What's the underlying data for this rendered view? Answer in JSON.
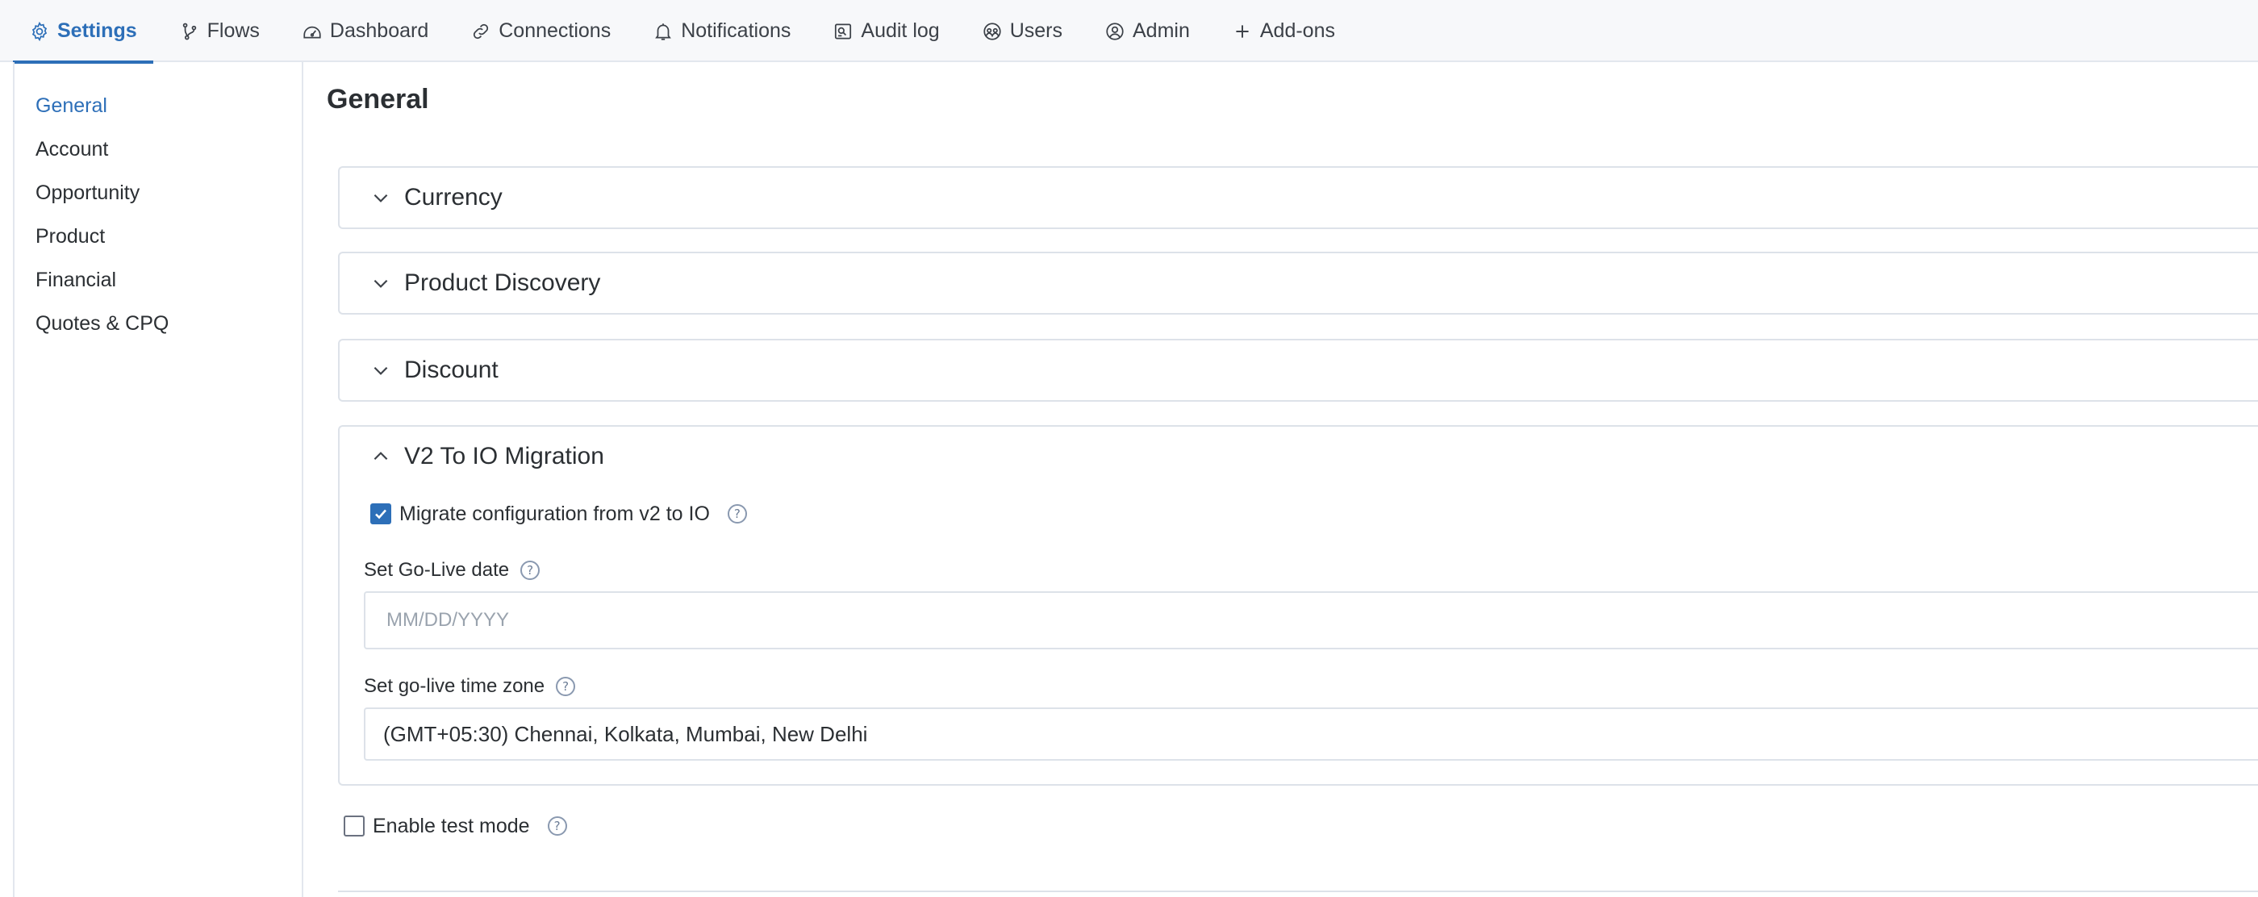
{
  "nav": {
    "tabs": [
      {
        "label": "Settings",
        "icon": "gear-icon"
      },
      {
        "label": "Flows",
        "icon": "flow-icon"
      },
      {
        "label": "Dashboard",
        "icon": "dashboard-icon"
      },
      {
        "label": "Connections",
        "icon": "link-icon"
      },
      {
        "label": "Notifications",
        "icon": "bell-icon"
      },
      {
        "label": "Audit log",
        "icon": "audit-log-icon"
      },
      {
        "label": "Users",
        "icon": "users-icon"
      },
      {
        "label": "Admin",
        "icon": "admin-icon"
      },
      {
        "label": "Add-ons",
        "icon": "plus-icon"
      }
    ],
    "active_tab": "Settings"
  },
  "sidebar": {
    "items": [
      {
        "label": "General"
      },
      {
        "label": "Account"
      },
      {
        "label": "Opportunity"
      },
      {
        "label": "Product"
      },
      {
        "label": "Financial"
      },
      {
        "label": "Quotes & CPQ"
      }
    ],
    "active_item": "General"
  },
  "main": {
    "title": "General",
    "sections": [
      {
        "title": "Currency",
        "expanded": false
      },
      {
        "title": "Product Discovery",
        "expanded": false
      },
      {
        "title": "Discount",
        "expanded": false
      },
      {
        "title": "V2 To IO Migration",
        "expanded": true
      }
    ],
    "migration": {
      "migrate_checkbox_label": "Migrate configuration from v2 to IO",
      "migrate_checked": true,
      "go_live_date_label": "Set Go-Live date",
      "go_live_date_placeholder": "MM/DD/YYYY",
      "go_live_date_value": "",
      "timezone_label": "Set go-live time zone",
      "timezone_value": "(GMT+05:30) Chennai, Kolkata, Mumbai, New Delhi"
    },
    "test_mode": {
      "label": "Enable test mode",
      "checked": false
    },
    "help_glyph": "?"
  },
  "colors": {
    "accent": "#2d6fb8",
    "border": "#dde2e9",
    "nav_background": "#f7f8fa",
    "text": "#2b2f33"
  }
}
